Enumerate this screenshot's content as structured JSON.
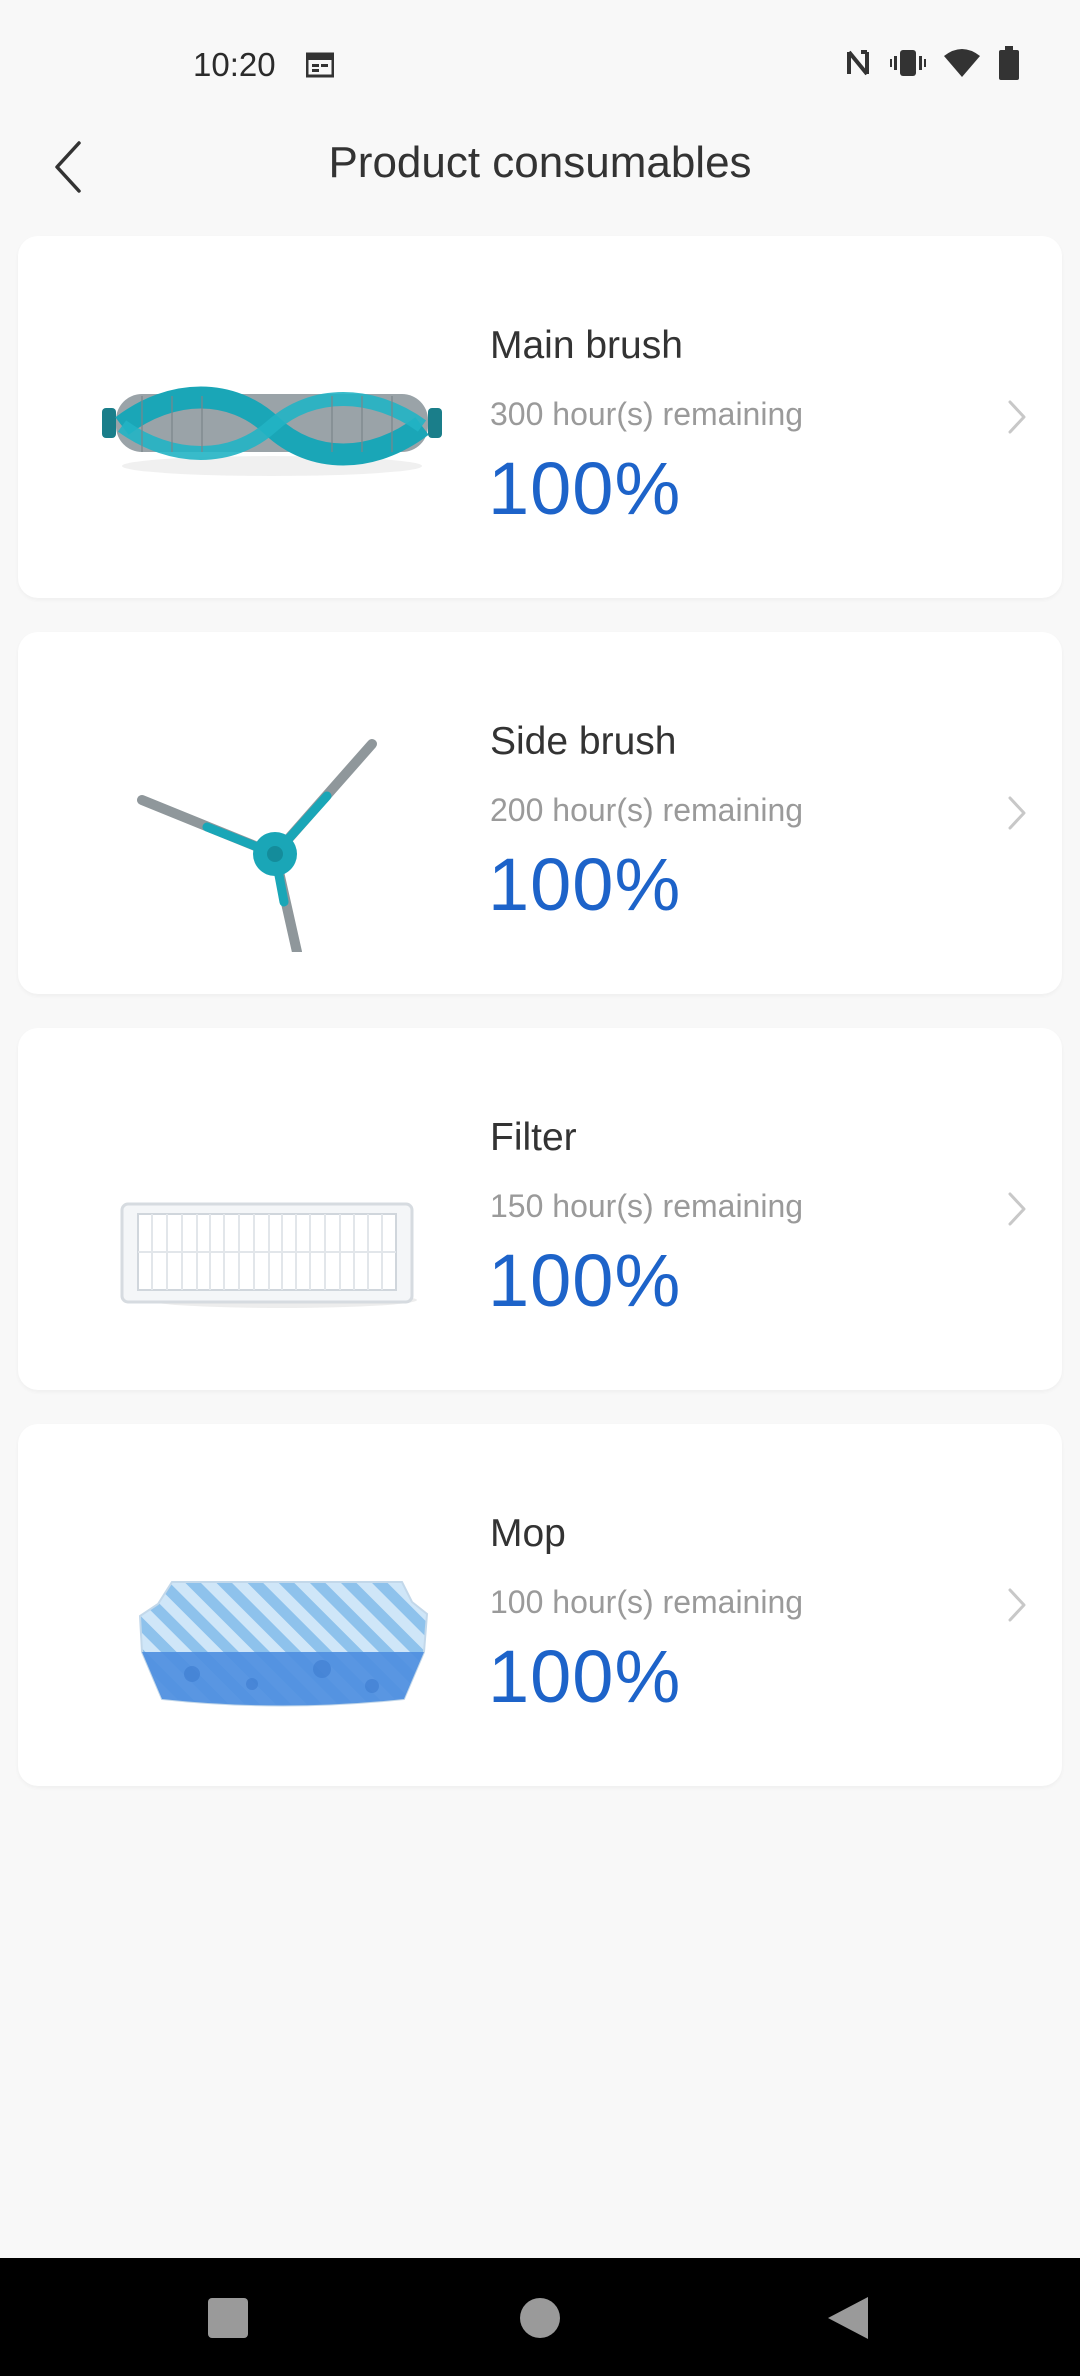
{
  "status_bar": {
    "time": "10:20",
    "icons": [
      "calendar-icon",
      "nfc-icon",
      "vibrate-icon",
      "wifi-icon",
      "battery-icon"
    ]
  },
  "header": {
    "title": "Product consumables",
    "back_icon": "back-arrow-icon"
  },
  "consumables": [
    {
      "name": "Main brush",
      "remaining": "300 hour(s) remaining",
      "percent": "100%",
      "image": "main-brush-image"
    },
    {
      "name": "Side brush",
      "remaining": "200 hour(s) remaining",
      "percent": "100%",
      "image": "side-brush-image"
    },
    {
      "name": "Filter",
      "remaining": "150 hour(s) remaining",
      "percent": "100%",
      "image": "filter-image"
    },
    {
      "name": "Mop",
      "remaining": "100 hour(s) remaining",
      "percent": "100%",
      "image": "mop-image"
    }
  ],
  "nav_bar": {
    "buttons": [
      "recents-button",
      "home-button",
      "back-button"
    ]
  },
  "colors": {
    "accent": "#1d63c9",
    "background": "#f8f8f8",
    "card": "#ffffff",
    "teal": "#1aa6b7"
  }
}
